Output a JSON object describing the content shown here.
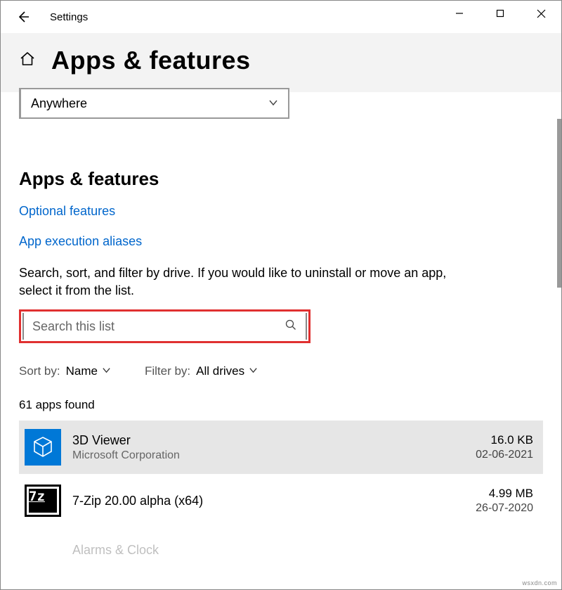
{
  "window": {
    "title": "Settings"
  },
  "header": {
    "title": "Apps & features"
  },
  "installSource": {
    "selected": "Anywhere"
  },
  "section": {
    "heading": "Apps & features",
    "link_optional": "Optional features",
    "link_aliases": "App execution aliases",
    "description": "Search, sort, and filter by drive. If you would like to uninstall or move an app, select it from the list."
  },
  "search": {
    "placeholder": "Search this list"
  },
  "sort": {
    "sort_label": "Sort by:",
    "sort_value": "Name",
    "filter_label": "Filter by:",
    "filter_value": "All drives"
  },
  "count_text": "61 apps found",
  "apps": [
    {
      "name": "3D Viewer",
      "publisher": "Microsoft Corporation",
      "size": "16.0 KB",
      "date": "02-06-2021"
    },
    {
      "name": "7-Zip 20.00 alpha (x64)",
      "publisher": "",
      "size": "4.99 MB",
      "date": "26-07-2020"
    },
    {
      "name": "Alarms & Clock",
      "publisher": "",
      "size": "",
      "date": ""
    }
  ],
  "watermark": "wsxdn.com"
}
